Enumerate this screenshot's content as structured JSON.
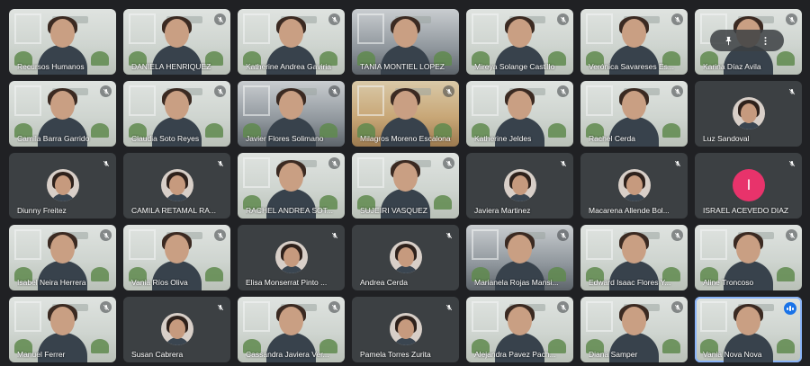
{
  "meeting": {
    "participants": [
      {
        "name": "Recursos Humanos",
        "muted": false,
        "camera": true
      },
      {
        "name": "DANIELA HENRIQUEZ",
        "muted": true,
        "camera": true
      },
      {
        "name": "Katherine Andrea Gaviria",
        "muted": true,
        "camera": true
      },
      {
        "name": "TANIA MONTIEL LOPEZ",
        "muted": false,
        "camera": true
      },
      {
        "name": "Mireya Solange Castillo",
        "muted": true,
        "camera": true
      },
      {
        "name": "Verónica Savareses Es...",
        "muted": true,
        "camera": true
      },
      {
        "name": "Karina Díaz Avila",
        "muted": true,
        "camera": true
      },
      {
        "name": "Camila Barra Garrido",
        "muted": true,
        "camera": true
      },
      {
        "name": "Claudia Soto Reyes",
        "muted": true,
        "camera": true
      },
      {
        "name": "Javier Flores Solimano",
        "muted": true,
        "camera": true
      },
      {
        "name": "Milagros Moreno Escalona",
        "muted": true,
        "camera": true
      },
      {
        "name": "Katherine Jeldes",
        "muted": true,
        "camera": true
      },
      {
        "name": "Rachel Cerda",
        "muted": true,
        "camera": true
      },
      {
        "name": "Luz Sandoval",
        "muted": true,
        "camera": false
      },
      {
        "name": "Diunny Freitez",
        "muted": true,
        "camera": false
      },
      {
        "name": "CAMILA RETAMAL RA...",
        "muted": true,
        "camera": false
      },
      {
        "name": "RACHEL ANDREA SOT...",
        "muted": true,
        "camera": true
      },
      {
        "name": "SUJEIRI VASQUEZ",
        "muted": true,
        "camera": true
      },
      {
        "name": "Javiera Martinez",
        "muted": true,
        "camera": false
      },
      {
        "name": "Macarena Allende Bol...",
        "muted": true,
        "camera": false
      },
      {
        "name": "ISRAEL ACEVEDO DIAZ",
        "muted": true,
        "camera": false,
        "avatar_letter": "I"
      },
      {
        "name": "Isabel Neira Herrera",
        "muted": true,
        "camera": true
      },
      {
        "name": "Vania Ríos Oliva",
        "muted": true,
        "camera": true
      },
      {
        "name": "Elisa Monserrat Pinto ...",
        "muted": true,
        "camera": false
      },
      {
        "name": "Andrea Cerda",
        "muted": true,
        "camera": false
      },
      {
        "name": "Marianela Rojas Mansi...",
        "muted": true,
        "camera": true
      },
      {
        "name": "Edward Isaac Flores Y...",
        "muted": true,
        "camera": true
      },
      {
        "name": "Aline Troncoso",
        "muted": true,
        "camera": true
      },
      {
        "name": "Manuel Ferrer",
        "muted": true,
        "camera": true
      },
      {
        "name": "Susan Cabrera",
        "muted": true,
        "camera": false
      },
      {
        "name": "Cassandra Javiera Ver...",
        "muted": true,
        "camera": true
      },
      {
        "name": "Pamela Torres Zurita",
        "muted": true,
        "camera": false
      },
      {
        "name": "Alejandra Pavez Pach...",
        "muted": true,
        "camera": true
      },
      {
        "name": "Diana Samper",
        "muted": true,
        "camera": true
      },
      {
        "name": "Vania Nova Nova",
        "muted": false,
        "camera": true,
        "speaking": true
      }
    ],
    "hover_actions": {
      "pin_icon": "pin-icon",
      "more_icon": "more-vert-icon"
    },
    "colors": {
      "background": "#202124",
      "tile_off": "#3c4043",
      "speaking_outline": "#8ab4f8",
      "avatar_letter_bg": "#e8336b"
    }
  }
}
